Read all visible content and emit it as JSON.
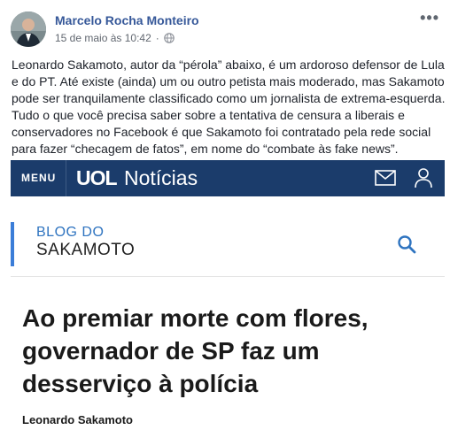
{
  "post": {
    "author": "Marcelo Rocha Monteiro",
    "date": "15 de maio às 10:42",
    "separator": "·",
    "more_menu": "•••",
    "privacy_icon": "globe-icon",
    "text_lines": [
      "Leonardo Sakamoto, autor da “pérola” abaixo, é um ardoroso defensor de Lula",
      "e do PT. Até existe (ainda) um ou outro petista mais moderado, mas Sakamoto",
      "pode ser tranquilamente classificado como um jornalista de extrema-esquerda.",
      "Tudo o que você precisa saber sobre a tentativa de censura a liberais e",
      "conservadores no Facebook é que Sakamoto foi contratado pela rede social",
      "para fazer “checagem de fatos”, em nome do “combate às fake news”."
    ]
  },
  "shared": {
    "menu_label": "MENU",
    "brand": "UOL",
    "section": "Notícias",
    "blog_line1": "BLOG DO",
    "blog_line2": "SAKAMOTO",
    "headline_lines": [
      "Ao premiar morte com flores,",
      "governador de SP faz um",
      "desserviço à polícia"
    ],
    "byline": "Leonardo Sakamoto",
    "icons": {
      "mail": "mail-icon",
      "user": "user-icon",
      "search": "search-icon"
    }
  },
  "colors": {
    "author_link": "#365899",
    "uol_bar": "#1b3c6b",
    "blog_accent": "#3b7dd8",
    "blog_title": "#2f74c0"
  }
}
